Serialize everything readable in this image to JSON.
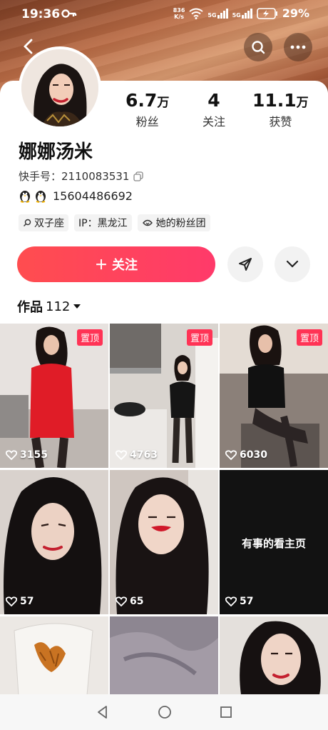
{
  "status_bar": {
    "time": "19:36",
    "net_speed_top": "836",
    "net_speed_bottom": "K/s",
    "sim1": "5G",
    "sim2": "5G",
    "battery": "29%"
  },
  "profile": {
    "followers": "6.7",
    "followers_unit": "万",
    "followers_label": "粉丝",
    "following": "4",
    "following_label": "关注",
    "likes": "11.1",
    "likes_unit": "万",
    "likes_label": "获赞",
    "username": "娜娜汤米",
    "uid_label": "快手号：",
    "uid_value": "2110083531",
    "qq_number": "15604486692",
    "tags": [
      "双子座",
      "IP：黑龙江",
      "她的粉丝团"
    ]
  },
  "actions": {
    "follow_label": "关注",
    "follow_plus": "＋"
  },
  "works": {
    "label": "作品",
    "count": "112"
  },
  "grid": [
    {
      "pin": "置顶",
      "likes": "3155"
    },
    {
      "pin": "置顶",
      "likes": "4763"
    },
    {
      "pin": "置顶",
      "likes": "6030"
    },
    {
      "likes": "57"
    },
    {
      "likes": "65"
    },
    {
      "likes": "57",
      "text": "有事的看主页"
    }
  ],
  "colors": {
    "accent": "#ff4d4f",
    "pin_bg": "#ff3355"
  }
}
